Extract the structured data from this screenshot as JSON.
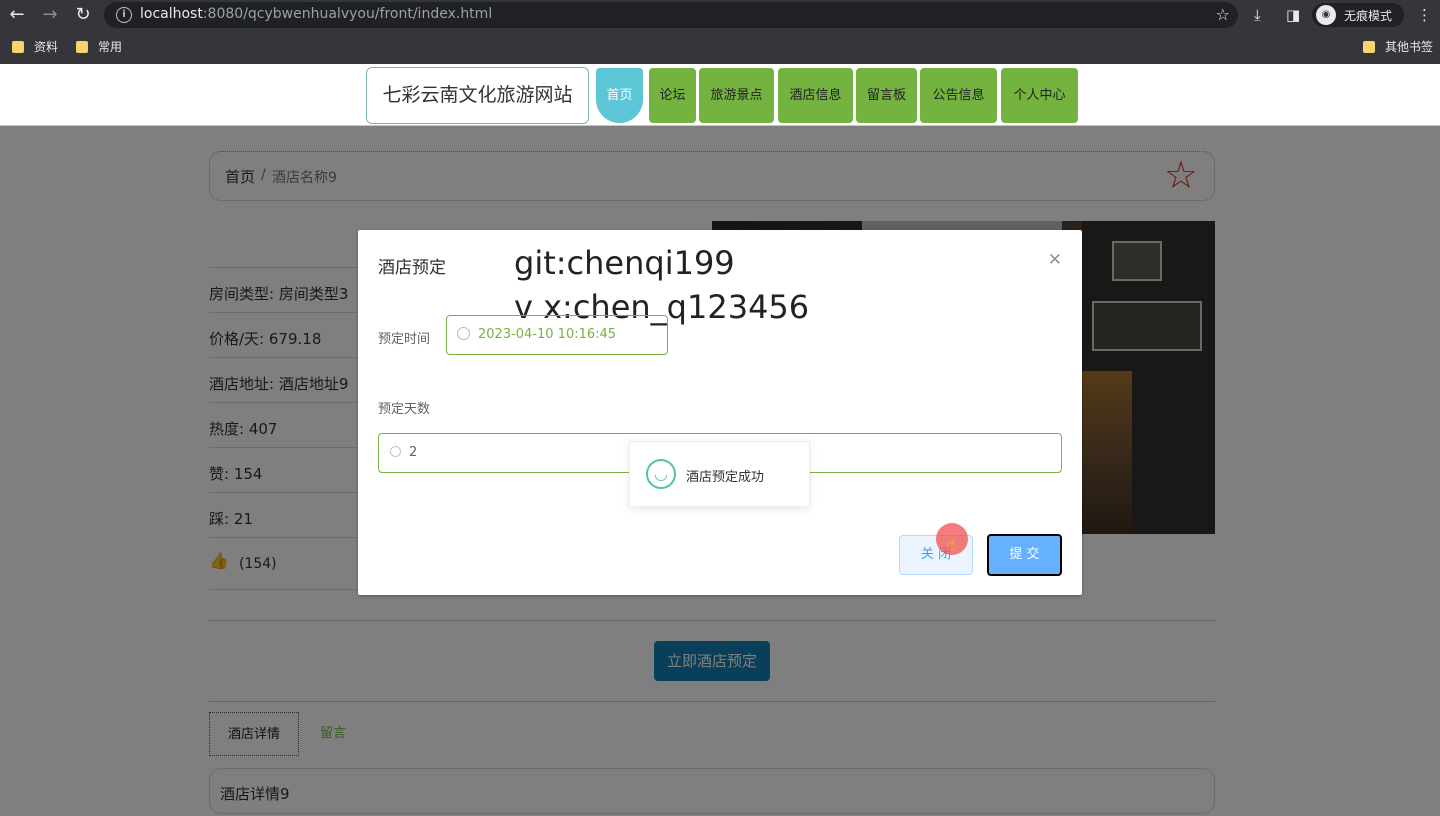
{
  "browser": {
    "url_host": "localhost",
    "url_rest": ":8080/qcybwenhualvyou/front/index.html",
    "incognito_label": "无痕模式",
    "bookmarks": [
      "资料",
      "常用"
    ],
    "other_bookmarks": "其他书签"
  },
  "nav": {
    "brand": "七彩云南文化旅游网站",
    "items": [
      "首页",
      "论坛",
      "旅游景点",
      "酒店信息",
      "留言板",
      "公告信息",
      "个人中心"
    ],
    "active_index": 0
  },
  "breadcrumb": {
    "home": "首页",
    "separator": "/",
    "current": "酒店名称9"
  },
  "hotel": {
    "room_type": "房间类型: 房间类型3",
    "price": "价格/天: 679.18",
    "address": "酒店地址: 酒店地址9",
    "heat": "热度: 407",
    "likes": "赞: 154",
    "dislikes": "踩: 21",
    "thumb_count": "(154)",
    "book_button": "立即酒店预定"
  },
  "tabs": [
    "酒店详情",
    "留言"
  ],
  "detail_text": "酒店详情9",
  "dialog": {
    "title": "酒店预定",
    "watermark_line1": "git:chenqi199",
    "watermark_line2": "v x:chen_q123456",
    "time_label": "预定时间",
    "time_value": "2023-04-10 10:16:45",
    "days_label": "预定天数",
    "days_value": "2",
    "close_button": "关 闭",
    "submit_button": "提 交"
  },
  "toast": {
    "message": "酒店预定成功"
  },
  "colors": {
    "nav_green": "#74b340",
    "nav_active": "#5cc6d6",
    "primary": "#409eff",
    "success": "#4fc59e"
  }
}
